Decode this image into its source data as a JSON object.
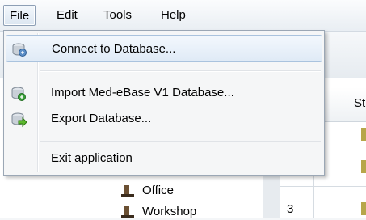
{
  "menubar": {
    "items": [
      "File",
      "Edit",
      "Tools",
      "Help"
    ],
    "active": "File"
  },
  "file_menu": {
    "items": [
      {
        "label": "Connect to Database...",
        "icon": "database-connect-icon"
      },
      {
        "label": "Import Med-eBase V1 Database...",
        "icon": "database-import-icon"
      },
      {
        "label": "Export Database...",
        "icon": "database-export-icon"
      },
      {
        "label": "Exit application",
        "icon": ""
      }
    ]
  },
  "tree": {
    "items": [
      "Office",
      "Workshop"
    ]
  },
  "grid": {
    "header_partial": "St",
    "row_number": "3"
  },
  "colors": {
    "menu_highlight": "#dfeaf6",
    "menu_border": "#9ba7b5",
    "db_blue": "#5b8ec7",
    "import_green": "#3aa13a",
    "export_green": "#5cb82e"
  }
}
